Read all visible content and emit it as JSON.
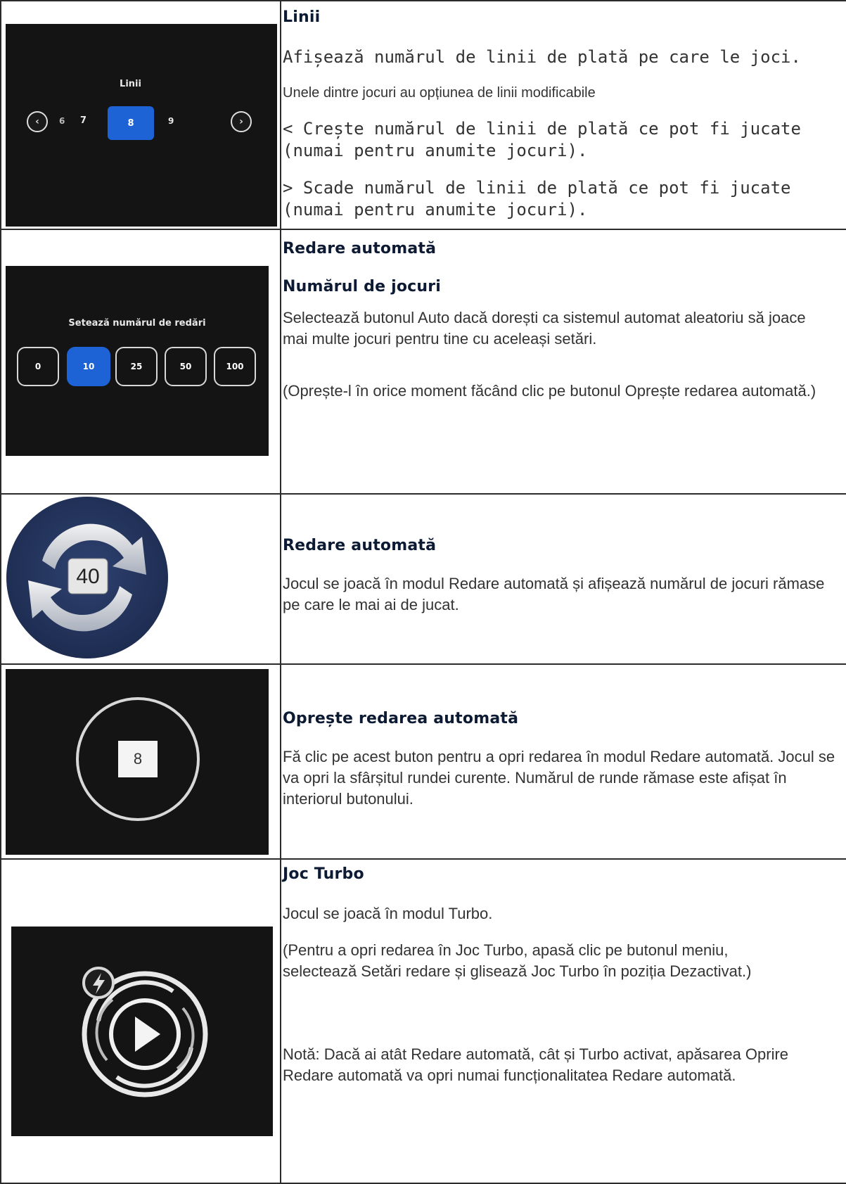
{
  "rows": [
    {
      "title": "Linii",
      "paragraphs": [
        "Afișează numărul de linii de plată pe care le joci.",
        "Unele dintre jocuri au opțiunea de linii modificabile",
        "< Crește numărul de linii de plată ce pot fi jucate (numai pentru anumite jocuri).",
        "> Scade numărul de linii de plată ce pot fi jucate (numai pentru anumite jocuri)."
      ],
      "image": {
        "label": "Linii",
        "left_icon": "chevron-left-icon",
        "right_icon": "chevron-right-icon",
        "values": [
          "6",
          "7",
          "8",
          "9"
        ],
        "selected": "8",
        "accent": "#1e63d6"
      }
    },
    {
      "title": "Redare automată",
      "subtitle": "Numărul de jocuri",
      "paragraphs": [
        "Selectează butonul Auto dacă dorești ca sistemul automat aleatoriu să joace mai multe jocuri pentru tine cu aceleași setări.",
        "(Oprește-l în orice moment făcând clic pe butonul Oprește redarea automată.)"
      ],
      "image": {
        "label": "Setează numărul de redări",
        "values": [
          "0",
          "10",
          "25",
          "50",
          "100"
        ],
        "selected": "10",
        "accent": "#1e63d6"
      }
    },
    {
      "title": "Redare automată",
      "paragraphs": [
        "Jocul se joacă în modul Redare automată și afișează numărul de jocuri rămase pe care le mai ai de jucat."
      ],
      "image": {
        "icon": "autoplay-refresh-icon",
        "count": "40",
        "bg": "#1f2f57"
      }
    },
    {
      "title": "Oprește redarea automată",
      "paragraphs": [
        "Fă clic pe acest buton pentru a opri redarea în modul Redare automată. Jocul se va opri la sfârșitul rundei curente. Numărul de runde rămase este afișat în interiorul butonului."
      ],
      "image": {
        "icon": "stop-autoplay-icon",
        "count": "8"
      }
    },
    {
      "title": "Joc Turbo",
      "paragraphs": [
        "Jocul se joacă în modul Turbo.",
        "(Pentru a opri redarea în Joc Turbo, apasă clic pe butonul meniu, selectează Setări redare și glisează Joc Turbo în poziția Dezactivat.)",
        "Notă: Dacă ai atât Redare automată, cât și Turbo activat, apăsarea Oprire Redare automată va opri numai funcționalitatea Redare automată."
      ],
      "image": {
        "icon": "turbo-play-icon",
        "badge_icon": "lightning-bolt-icon"
      }
    }
  ]
}
